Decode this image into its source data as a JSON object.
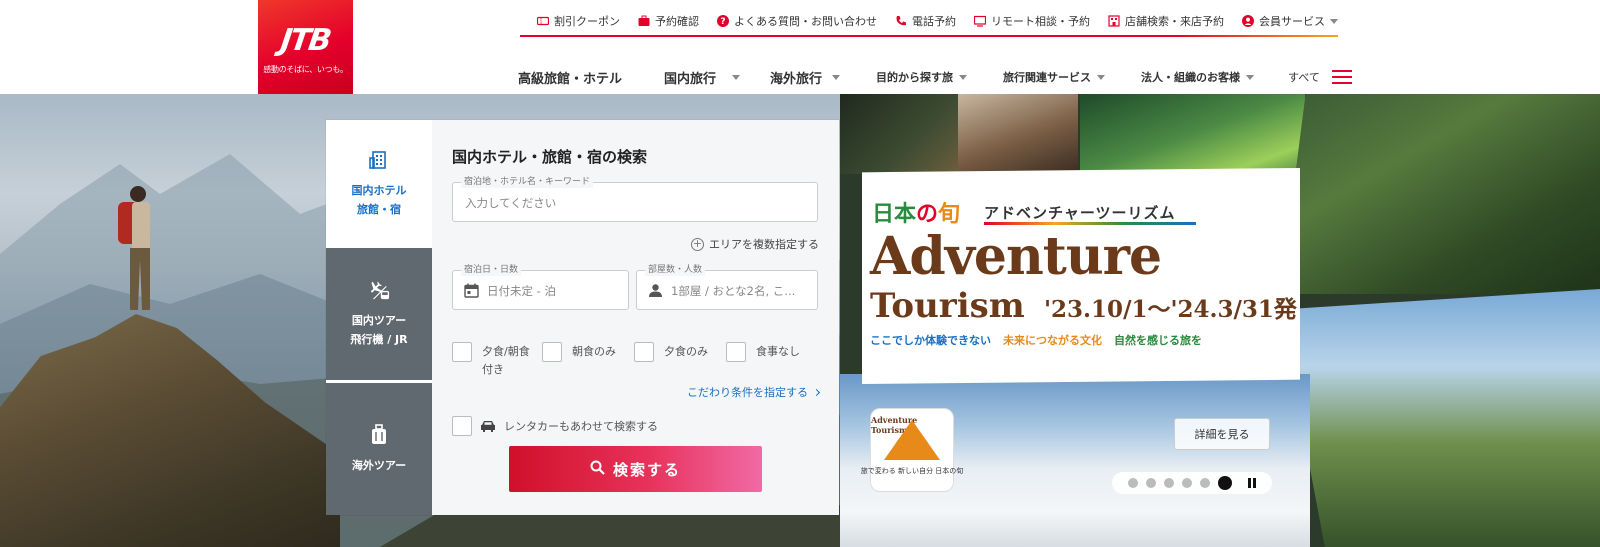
{
  "brand": {
    "logo_text": "JTB",
    "tagline": "感動のそばに、いつも。",
    "color": "#e4002b"
  },
  "utility_nav": [
    {
      "label": "割引クーポン",
      "icon": "coupon-icon"
    },
    {
      "label": "予約確認",
      "icon": "briefcase-icon"
    },
    {
      "label": "よくある質問・お問い合わせ",
      "icon": "question-icon"
    },
    {
      "label": "電話予約",
      "icon": "phone-icon"
    },
    {
      "label": "リモート相談・予約",
      "icon": "monitor-icon"
    },
    {
      "label": "店舗検索・来店予約",
      "icon": "store-icon"
    },
    {
      "label": "会員サービス",
      "icon": "user-icon"
    }
  ],
  "main_nav": {
    "items": [
      {
        "label": "高級旅館・ホテル"
      },
      {
        "label": "国内旅行"
      },
      {
        "label": "海外旅行"
      },
      {
        "label": "目的から探す旅"
      },
      {
        "label": "旅行関連サービス"
      },
      {
        "label": "法人・組織のお客様"
      }
    ],
    "all_label": "すべて"
  },
  "search": {
    "tabs": [
      {
        "label_line1": "国内ホテル",
        "label_line2": "旅館・宿",
        "icon": "building-icon",
        "active": true
      },
      {
        "label_line1": "国内ツアー",
        "label_line2": "飛行機 / JR",
        "icon": "plane-train-icon",
        "active": false
      },
      {
        "label_line1": "海外ツアー",
        "label_line2": "",
        "icon": "suitcase-icon",
        "active": false
      }
    ],
    "title": "国内ホテル・旅館・宿の検索",
    "keyword": {
      "label": "宿泊地・ホテル名・キーワード",
      "placeholder": "入力してください"
    },
    "area_link": "エリアを複数指定する",
    "date": {
      "label": "宿泊日・日数",
      "value": "日付未定 - 泊"
    },
    "rooms": {
      "label": "部屋数・人数",
      "value": "1部屋 / おとな2名, こ..."
    },
    "meals": [
      "夕食/朝食付き",
      "朝食のみ",
      "夕食のみ",
      "食事なし"
    ],
    "kodawari_link": "こだわり条件を指定する",
    "rental_car_label": "レンタカーもあわせて検索する",
    "submit_label": "検索する"
  },
  "banner": {
    "brand_1": "日本",
    "brand_2": "の",
    "brand_3": "旬",
    "kana": "アドベンチャーツーリズム",
    "title": "Adventure",
    "title2": "Tourism",
    "dates": "'23.10/1～'24.3/31発",
    "sub": [
      "ここでしか体験できない",
      "未来につながる文化",
      "自然を感じる旅を"
    ],
    "badge_label": "Adventure Tourism",
    "badge_foot": "旅で変わる 新しい自分 日本の旬",
    "detail_label": "詳細を見る",
    "slide_count": 6,
    "active_slide": 6
  }
}
